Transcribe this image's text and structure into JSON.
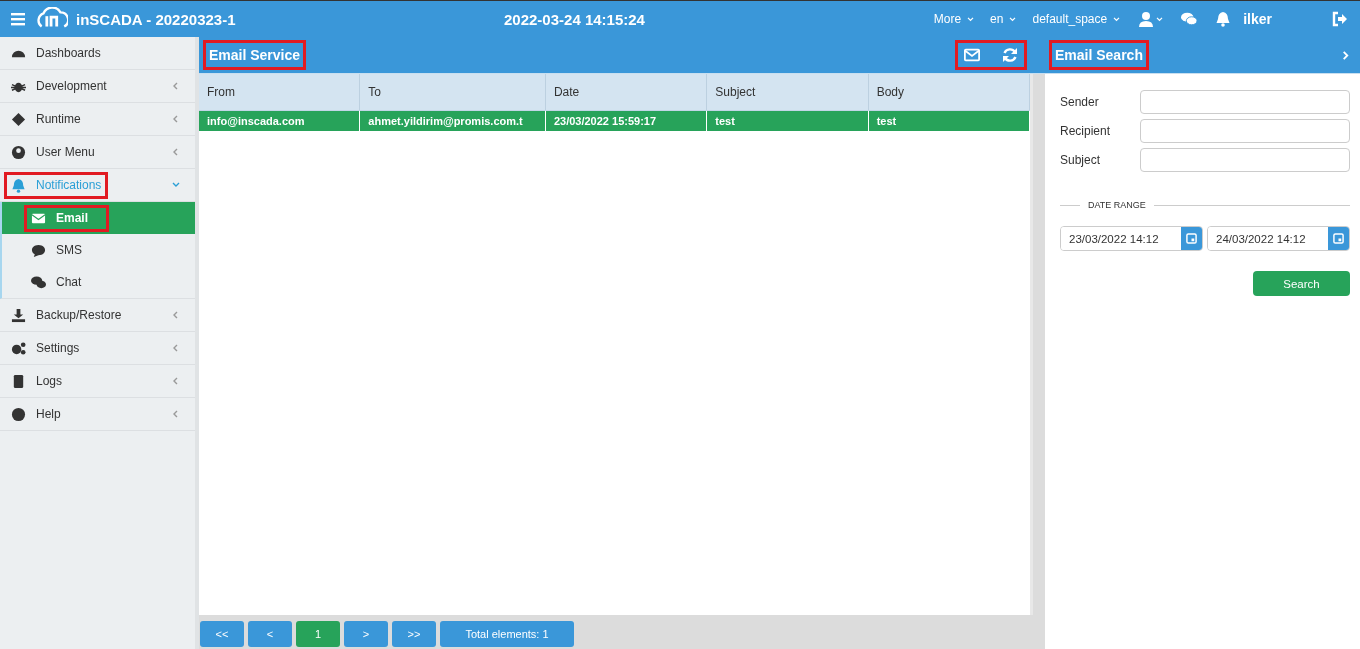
{
  "topbar": {
    "title": "inSCADA - 20220323-1",
    "datetime": "2022-03-24 14:15:24",
    "menus": [
      "More",
      "en",
      "default_space"
    ],
    "user": "ilker"
  },
  "sidebar": {
    "items": [
      {
        "label": "Dashboards",
        "kind": "link",
        "highlighted": false
      },
      {
        "label": "Development",
        "kind": "group",
        "expanded": false,
        "highlighted": false
      },
      {
        "label": "Runtime",
        "kind": "group",
        "expanded": false,
        "highlighted": false
      },
      {
        "label": "User Menu",
        "kind": "group",
        "expanded": false,
        "highlighted": false
      },
      {
        "label": "Notifications",
        "kind": "group",
        "expanded": true,
        "highlighted": true,
        "children": [
          {
            "label": "Email",
            "selected": true,
            "highlighted": true
          },
          {
            "label": "SMS",
            "selected": false,
            "highlighted": false
          },
          {
            "label": "Chat",
            "selected": false,
            "highlighted": false
          }
        ]
      },
      {
        "label": "Backup/Restore",
        "kind": "group",
        "expanded": false,
        "highlighted": false
      },
      {
        "label": "Settings",
        "kind": "group",
        "expanded": false,
        "highlighted": false
      },
      {
        "label": "Logs",
        "kind": "group",
        "expanded": false,
        "highlighted": false
      },
      {
        "label": "Help",
        "kind": "group",
        "expanded": false,
        "highlighted": false
      }
    ]
  },
  "main": {
    "title": "Email Service",
    "title_highlighted": true,
    "toolbar_highlighted": true,
    "table": {
      "columns": [
        "From",
        "To",
        "Date",
        "Subject",
        "Body"
      ],
      "rows": [
        {
          "cells": [
            "info@inscada.com",
            "ahmet.yildirim@promis.com.t",
            "23/03/2022 15:59:17",
            "test",
            "test"
          ],
          "selected": true
        }
      ]
    },
    "pager": {
      "buttons": [
        {
          "label": "<<",
          "selected": false
        },
        {
          "label": "<",
          "selected": false
        },
        {
          "label": "1",
          "selected": true
        },
        {
          "label": ">",
          "selected": false
        },
        {
          "label": ">>",
          "selected": false
        }
      ],
      "total": "Total elements: 1"
    }
  },
  "search_panel": {
    "title": "Email Search",
    "title_highlighted": true,
    "fields": [
      {
        "label": "Sender"
      },
      {
        "label": "Recipient"
      },
      {
        "label": "Subject"
      }
    ],
    "date_range": {
      "legend": "DATE RANGE",
      "from": "23/03/2022 14:12",
      "to": "24/03/2022 14:12"
    },
    "button": "Search"
  }
}
